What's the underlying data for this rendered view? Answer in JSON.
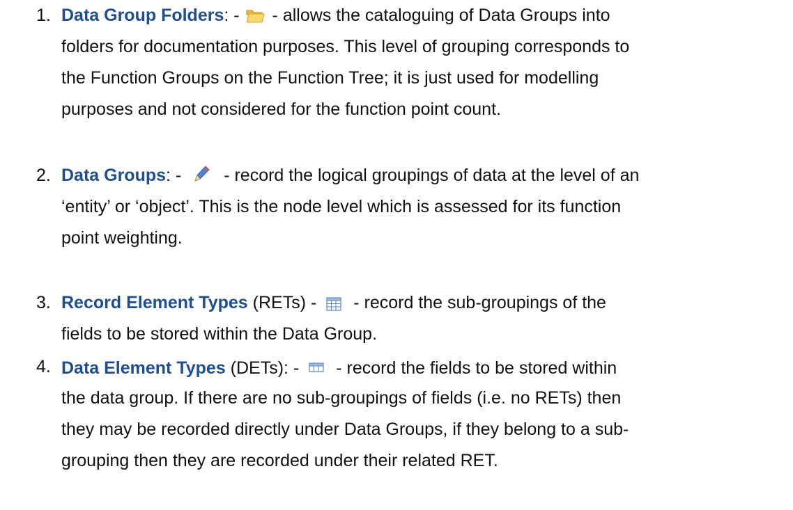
{
  "items": [
    {
      "number": "1.",
      "term": "Data Group Folders",
      "after_term": ": -",
      "icon": "folder-icon",
      "line1_rest": "- allows the cataloguing of Data Groups into",
      "lines": [
        "folders for documentation purposes.  This level of grouping corresponds to",
        "the Function Groups on the Function Tree; it is just used for modelling",
        "purposes and not considered for the function point count."
      ]
    },
    {
      "number": "2.",
      "term": "Data Groups",
      "after_term": ": -",
      "icon": "pencil-icon",
      "line1_rest": "- record the logical groupings of data at the level of an",
      "lines": [
        "‘entity’ or ‘object’. This is the node level which is assessed for its function",
        "point weighting."
      ]
    },
    {
      "number": "3.",
      "term": "Record Element Types",
      "after_term": " (RETs) -",
      "icon": "table-icon",
      "line1_rest": "- record the sub-groupings of the",
      "lines": [
        "fields to be stored within the Data Group."
      ]
    },
    {
      "number": "4.",
      "term": "Data Element Types",
      "after_term": " (DETs): -",
      "icon": "field-icon",
      "line1_rest": "- record the fields to be stored within",
      "lines": [
        "the data group.  If there are no sub-groupings of fields (i.e. no RETs) then",
        "they may be recorded directly under Data Groups, if they belong to a sub-",
        "grouping then they are recorded under their related RET."
      ]
    }
  ]
}
